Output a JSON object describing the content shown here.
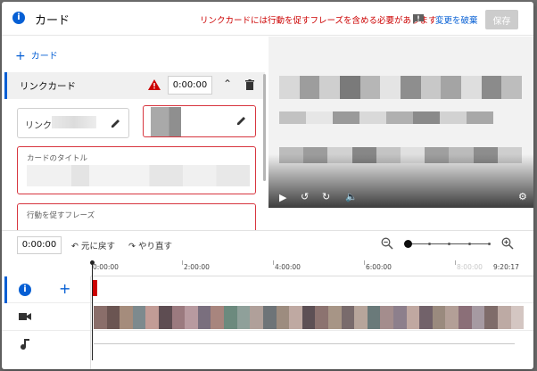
{
  "header": {
    "title": "カード",
    "error_message": "リンクカードには行動を促すフレーズを含める必要があります",
    "discard_label": "変更を破棄",
    "save_label": "保存"
  },
  "left_panel": {
    "add_card_label": "カード",
    "card": {
      "type_label": "リンクカード",
      "time": "0:00:00"
    },
    "link_field_label": "リンク:",
    "title_field_label": "カードのタイトル",
    "cta_field_label": "行動を促すフレーズ"
  },
  "timeline": {
    "current_time": "0:00:00",
    "undo_label": "元に戻す",
    "redo_label": "やり直す",
    "ruler_labels": [
      "0:00:00",
      "2:00:00",
      "4:00:00",
      "6:00:00",
      "8:00:00",
      "9:20:17"
    ]
  },
  "colors": {
    "accent": "#065fd4",
    "error": "#cc0000",
    "save_disabled": "#cccccc"
  }
}
